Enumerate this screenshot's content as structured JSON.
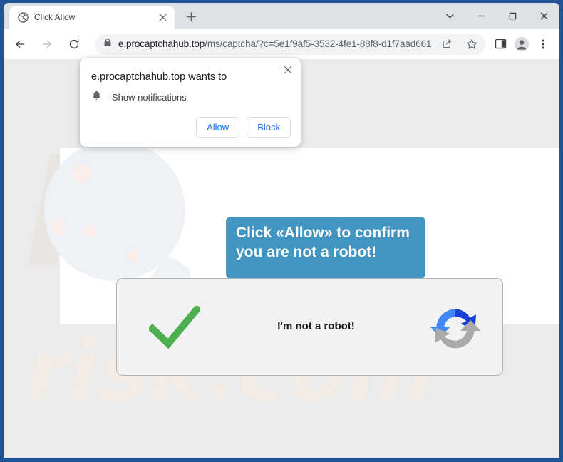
{
  "window": {
    "controls": [
      {
        "name": "tab-search-button",
        "glyph": "chevron-down"
      },
      {
        "name": "minimize-button",
        "glyph": "minimize"
      },
      {
        "name": "maximize-button",
        "glyph": "maximize"
      },
      {
        "name": "close-button",
        "glyph": "close"
      }
    ]
  },
  "tabstrip": {
    "tabs": [
      {
        "title": "Click Allow",
        "favicon": "globe-icon",
        "close_label": "Close tab"
      }
    ],
    "new_tab_label": "New tab"
  },
  "toolbar": {
    "back_label": "Back",
    "forward_label": "Forward",
    "reload_label": "Reload",
    "lock_icon": "lock-icon",
    "url_host": "e.procaptchahub.top",
    "url_path": "/ms/captcha/?c=5e1f9af5-3532-4fe1-88f8-d1f7aad661...",
    "url_full": "e.procaptchahub.top/ms/captcha/?c=5e1f9af5-3532-4fe1-88f8-d1f7aad661...",
    "share_label": "Share this page",
    "bookmark_label": "Bookmark this tab",
    "side_panel_label": "Side panel",
    "profile_label": "Profile",
    "menu_label": "Customize and control Google Chrome"
  },
  "permission_dialog": {
    "title": "e.procaptchahub.top wants to",
    "permission_icon": "bell-icon",
    "permission_label": "Show notifications",
    "allow_label": "Allow",
    "block_label": "Block",
    "close_label": "Close",
    "allow_color": "#1a73e8"
  },
  "page": {
    "banner_text": "Click «Allow» to confirm you are not a robot!",
    "banner_color": "#4295c0",
    "captcha": {
      "label": "I'm not a robot!",
      "check_icon": "green-checkmark-icon",
      "check_color": "#4caf50",
      "logo_icon": "recaptcha-refresh-icon",
      "logo_colors": {
        "light_blue": "#4285f4",
        "dark_blue": "#1a3fd4",
        "gray": "#aaaaaa"
      }
    },
    "watermark_top": "PC",
    "watermark_bottom": "risk.com",
    "watermark_color": "#efe8e0"
  }
}
